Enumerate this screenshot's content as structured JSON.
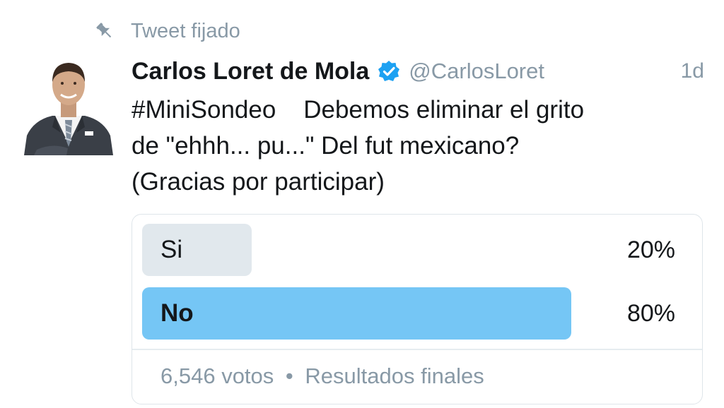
{
  "pinned": {
    "icon": "pin-icon",
    "label": "Tweet fijado"
  },
  "tweet": {
    "author": {
      "name": "Carlos Loret de Mola",
      "verified": true,
      "verified_icon": "verified-badge-icon",
      "handle": "@CarlosLoret",
      "avatar": "avatar-photo"
    },
    "timestamp": "1d",
    "text_lines": [
      "#MiniSondeo    Debemos eliminar el grito",
      "de \"ehhh... pu...\" Del fut mexicano?",
      "(Gracias por participar)"
    ]
  },
  "poll": {
    "options": [
      {
        "label": "Si",
        "percent_text": "20%",
        "percent": 20,
        "winner": false
      },
      {
        "label": "No",
        "percent_text": "80%",
        "percent": 80,
        "winner": true
      }
    ],
    "votes": "6,546 votos",
    "separator": "•",
    "status": "Resultados finales"
  },
  "colors": {
    "accent": "#1da1f2",
    "winner_bar": "#75c6f5",
    "loser_bar": "#e1e8ed",
    "muted_text": "#8899a6",
    "border": "#dfe5ea"
  }
}
